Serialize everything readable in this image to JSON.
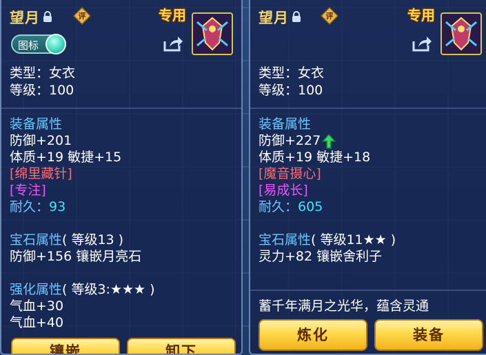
{
  "left": {
    "name": "望月",
    "special": "专用",
    "toggle_label": "图标",
    "type_line": "类型：女衣",
    "level_line": "等级：100",
    "equip_title": "装备属性",
    "defense": "防御+201",
    "stats": "体质+19 敏捷+15",
    "effect1": "[绵里藏针]",
    "effect2": "[专注]",
    "durability_label": "耐久：",
    "durability_value": "93",
    "gem_title": "宝石属性",
    "gem_level": "( 等级13 )",
    "gem_line": "防御+156 镶嵌月亮石",
    "enhance_title": "强化属性",
    "enhance_level": "( 等级3:★★★ )",
    "enhance_line1": "气血+30",
    "enhance_line2": "气血+40",
    "btn_inlay": "镶嵌",
    "btn_unequip": "卸下"
  },
  "right": {
    "name": "望月",
    "special": "专用",
    "type_line": "类型：女衣",
    "level_line": "等级：100",
    "equip_title": "装备属性",
    "defense": "防御+227",
    "stats": "体质+19 敏捷+18",
    "effect1": "[魔音摄心]",
    "effect2": "[易成长]",
    "durability_label": "耐久：",
    "durability_value": "605",
    "gem_title": "宝石属性",
    "gem_level": "( 等级11★★ )",
    "gem_line": "灵力+82 镶嵌舍利子",
    "description": "蓄千年满月之光华，蕴含灵通",
    "btn_refine": "炼化",
    "btn_equip": "装备"
  },
  "icons": {
    "lock": "lock-icon",
    "rating": "rating-badge-icon",
    "share": "share-icon",
    "portrait": "character-portrait-icon",
    "upgrade": "green-up-arrow-icon"
  },
  "colors": {
    "title": "#f5d56a",
    "section": "#6cc6ff",
    "effect_red": "#ff6a72",
    "effect_magenta": "#f154ff",
    "durability": "#39e7ff",
    "button": "#ffd84a"
  }
}
